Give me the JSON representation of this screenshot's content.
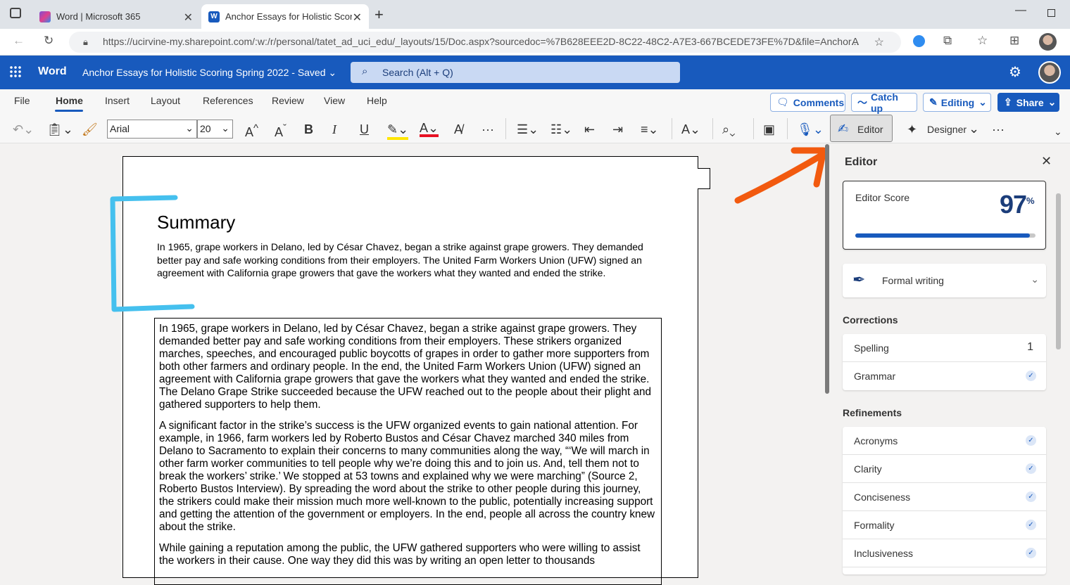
{
  "browser": {
    "tabs": [
      {
        "title": "Word | Microsoft 365",
        "active": false
      },
      {
        "title": "Anchor Essays for Holistic Scoring Spring 2022",
        "active": true
      }
    ],
    "url": "https://ucirvine-my.sharepoint.com/:w:/r/personal/tatet_ad_uci_edu/_layouts/15/Doc.aspx?sourcedoc=%7B628EEE2D-8C22-48C2-A7E3-667BCEDE73FE%7D&file=Anchor...",
    "read_aloud_label": "A"
  },
  "word": {
    "app_name": "Word",
    "doc_title": "Anchor Essays for Holistic Scoring Spring 2022",
    "save_status": "Saved",
    "search_placeholder": "Search (Alt + Q)"
  },
  "ribbon": {
    "tabs": [
      "File",
      "Home",
      "Insert",
      "Layout",
      "References",
      "Review",
      "View",
      "Help"
    ],
    "active_tab": "Home",
    "comments": "Comments",
    "catchup": "Catch up",
    "editing": "Editing",
    "share": "Share",
    "font": "Arial",
    "size": "20",
    "editor_btn": "Editor",
    "designer_btn": "Designer"
  },
  "document": {
    "heading": "Summary",
    "summary": "In 1965, grape workers in Delano, led by César Chavez, began a strike against grape growers. They demanded better pay and safe working conditions from their employers. The United Farm Workers Union (UFW) signed an agreement with California grape growers that gave the workers what they wanted and ended the strike.",
    "paragraphs": [
      "In 1965, grape workers in Delano, led by César Chavez, began a strike against grape growers. They demanded better pay and safe working conditions from their employers. These strikers organized marches, speeches, and encouraged public boycotts of grapes in order to gather more supporters from both other farmers and ordinary people. In the end, the United Farm Workers Union (UFW) signed an agreement with California grape growers that gave the workers what they wanted and ended the strike. The Delano Grape Strike succeeded because the UFW reached out to the people about their plight and gathered supporters to help them.",
      "A significant factor in the strike’s success is the UFW organized events to gain national attention. For example, in 1966, farm workers led by Roberto Bustos and César Chavez marched 340 miles from Delano to Sacramento to explain their concerns to many communities along the way, “‘We will march in other farm worker communities to tell people why we’re doing this and to join us. And, tell them not to break the workers’ strike.’ We stopped at 53 towns and explained why we were marching” (Source 2, Roberto Bustos Interview). By spreading the word about the strike to other people during this journey, the strikers could make their mission much more well-known to the public, potentially increasing support and getting the attention of the government or employers. In the end, people all across the country knew about the strike.",
      "While gaining a reputation among the public, the UFW gathered supporters who were willing to assist the workers in their cause. One way they did this was by writing an open letter to thousands"
    ]
  },
  "editor": {
    "title": "Editor",
    "score_label": "Editor Score",
    "score": "97",
    "score_unit": "%",
    "score_fraction": 0.97,
    "writing_style": "Formal writing",
    "corrections_title": "Corrections",
    "corrections": [
      {
        "label": "Spelling",
        "value": "1"
      },
      {
        "label": "Grammar",
        "value": ""
      }
    ],
    "refinements_title": "Refinements",
    "refinements": [
      "Acronyms",
      "Clarity",
      "Conciseness",
      "Formality",
      "Inclusiveness"
    ]
  },
  "colors": {
    "word_blue": "#185abd",
    "highlight_bracket": "#45c0ee",
    "arrow": "#f25a0f"
  }
}
